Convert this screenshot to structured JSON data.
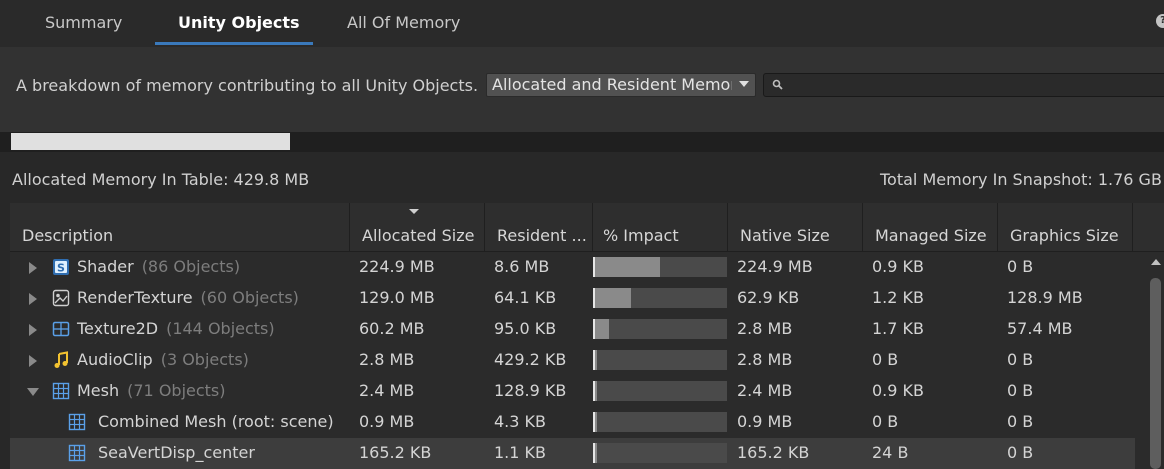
{
  "tabs": [
    {
      "label": "Summary",
      "active": false
    },
    {
      "label": "Unity Objects",
      "active": true
    },
    {
      "label": "All Of Memory",
      "active": false
    }
  ],
  "toolbar": {
    "description": "A breakdown of memory contributing to all Unity Objects.",
    "dropdown_value": "Allocated and Resident Memor",
    "search_value": ""
  },
  "memory_bar_fraction": 0.24,
  "summary": {
    "allocated_in_table": "Allocated Memory In Table: 429.8 MB",
    "total_in_snapshot": "Total Memory In Snapshot: 1.76 GB"
  },
  "columns": {
    "description": "Description",
    "allocated": "Allocated Size",
    "resident": "Resident ...",
    "impact": "% Impact",
    "native": "Native Size",
    "managed": "Managed Size",
    "graphics": "Graphics Size"
  },
  "rows": [
    {
      "expander": "collapsed",
      "icon": "shader-icon",
      "name": "Shader",
      "count": "(86 Objects)",
      "allocated": "224.9 MB",
      "resident": "8.6 MB",
      "impact": 0.5,
      "native": "224.9 MB",
      "managed": "0.9 KB",
      "graphics": "0 B"
    },
    {
      "expander": "collapsed",
      "icon": "render-texture-icon",
      "name": "RenderTexture",
      "count": "(60 Objects)",
      "allocated": "129.0 MB",
      "resident": "64.1 KB",
      "impact": 0.28,
      "native": "62.9 KB",
      "managed": "1.2 KB",
      "graphics": "128.9 MB"
    },
    {
      "expander": "collapsed",
      "icon": "texture2d-icon",
      "name": "Texture2D",
      "count": "(144 Objects)",
      "allocated": "60.2 MB",
      "resident": "95.0 KB",
      "impact": 0.12,
      "native": "2.8 MB",
      "managed": "1.7 KB",
      "graphics": "57.4 MB"
    },
    {
      "expander": "collapsed",
      "icon": "audio-clip-icon",
      "name": "AudioClip",
      "count": "(3 Objects)",
      "allocated": "2.8 MB",
      "resident": "429.2 KB",
      "impact": 0.03,
      "native": "2.8 MB",
      "managed": "0 B",
      "graphics": "0 B"
    },
    {
      "expander": "expanded",
      "icon": "mesh-icon",
      "name": "Mesh",
      "count": "(71 Objects)",
      "allocated": "2.4 MB",
      "resident": "128.9 KB",
      "impact": 0.03,
      "native": "2.4 MB",
      "managed": "0.9 KB",
      "graphics": "0 B"
    },
    {
      "expander": "none",
      "icon": "mesh-icon",
      "name": "Combined Mesh (root: scene)",
      "count": "",
      "allocated": "0.9 MB",
      "resident": "4.3 KB",
      "impact": 0.03,
      "native": "0.9 MB",
      "managed": "0 B",
      "graphics": "0 B"
    },
    {
      "expander": "none",
      "icon": "mesh-icon",
      "name": "SeaVertDisp_center",
      "count": "",
      "allocated": "165.2 KB",
      "resident": "1.1 KB",
      "impact": 0.03,
      "native": "165.2 KB",
      "managed": "24 B",
      "graphics": "0 B",
      "selected": true
    }
  ],
  "colors": {
    "accent": "#3a79bb",
    "shader_icon": "#5aa0e8",
    "audio_icon": "#f2c230",
    "mesh_icon": "#5aa0e8"
  }
}
